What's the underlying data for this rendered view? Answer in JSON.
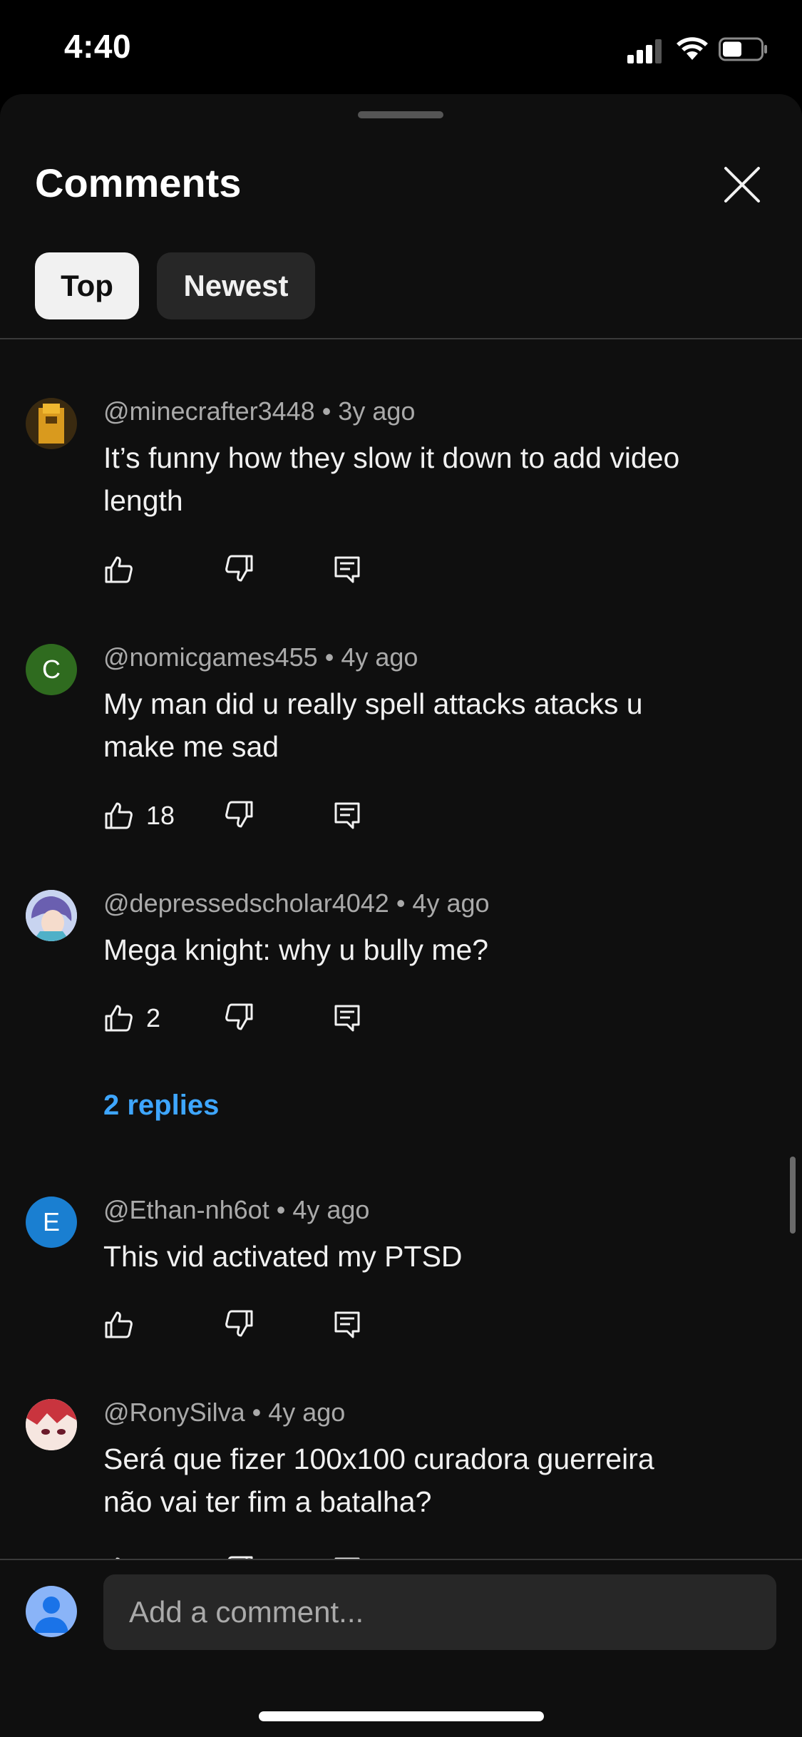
{
  "status_bar": {
    "time": "4:40"
  },
  "sheet": {
    "title": "Comments",
    "chips": [
      {
        "label": "Top",
        "selected": true
      },
      {
        "label": "Newest",
        "selected": false
      }
    ]
  },
  "comments": [
    {
      "author": "@minecrafter3448",
      "time": "3y ago",
      "lines": [
        "It’s funny how they slow it down to add video",
        "length"
      ],
      "likes": "",
      "avatar": "image",
      "avatar_color": "#c98a1a"
    },
    {
      "author": "@nomicgames455",
      "time": "4y ago",
      "lines": [
        "My man did u really spell attacks atacks u",
        "make me sad"
      ],
      "likes": "18",
      "avatar": "C",
      "avatar_color": "#2f6b1f"
    },
    {
      "author": "@depressedscholar4042",
      "time": "4y ago",
      "lines": [
        "Mega knight: why u bully me?"
      ],
      "likes": "2",
      "avatar": "image",
      "avatar_color": "#8a7fc4",
      "replies": "2 replies"
    },
    {
      "author": "@Ethan-nh6ot",
      "time": "4y ago",
      "lines": [
        "This vid activated my PTSD"
      ],
      "likes": "",
      "avatar": "E",
      "avatar_color": "#1a7fd1"
    },
    {
      "author": "@RonySilva",
      "time": "4y ago",
      "lines": [
        "Será que fizer 100x100 curadora guerreira",
        "não vai ter fim a batalha?"
      ],
      "likes": "",
      "avatar": "image",
      "avatar_color": "#c9434a"
    }
  ],
  "composer": {
    "placeholder": "Add a comment..."
  },
  "colors": {
    "background": "#0f0f0f",
    "link": "#3ea6ff",
    "chip_selected": "#f1f1f1",
    "chip": "#272727"
  }
}
